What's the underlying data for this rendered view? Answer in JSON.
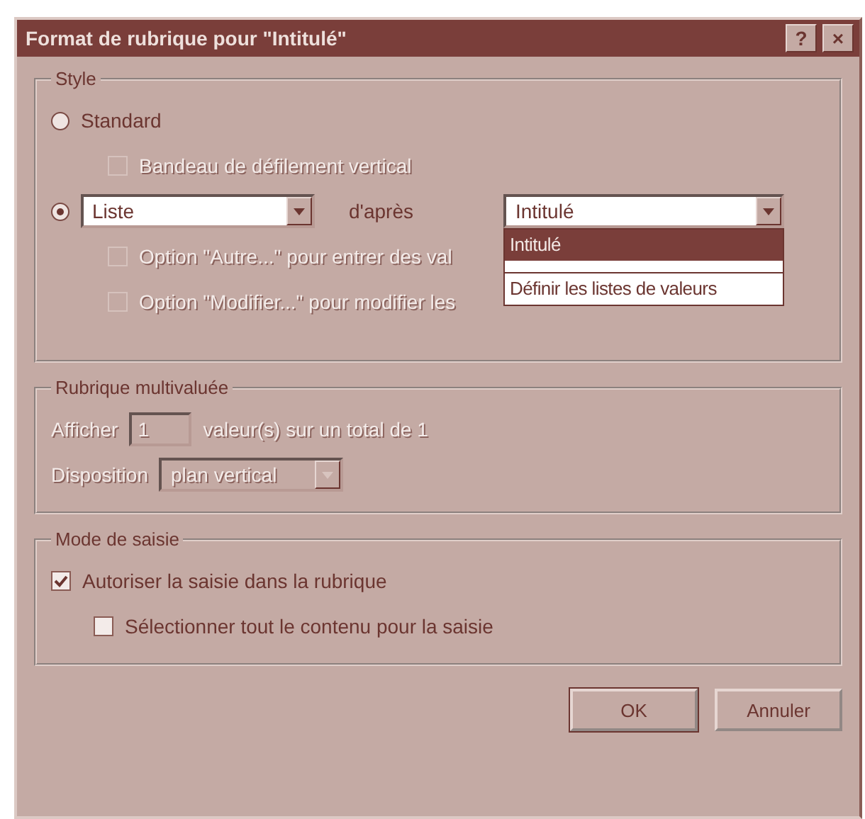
{
  "window": {
    "title": "Format de rubrique pour \"Intitulé\"",
    "help_button": "?",
    "close_button": "×"
  },
  "style_group": {
    "title": "Style",
    "standard": {
      "label": "Standard",
      "selected": false
    },
    "scrollbar_option": {
      "label": "Bandeau de défilement vertical",
      "checked": false,
      "disabled": true
    },
    "list": {
      "selected": true,
      "type_value": "Liste",
      "after_label": "d'après",
      "source_value": "Intitulé"
    },
    "list_options": [
      {
        "label": "Option \"Autre...\" pour entrer des val",
        "checked": false,
        "disabled": true
      },
      {
        "label": "Option \"Modifier...\" pour modifier les",
        "checked": false,
        "disabled": true
      }
    ],
    "dropdown": {
      "items": [
        {
          "label": "Intitulé",
          "selected": true
        },
        {
          "selected": false,
          "kind": "blank"
        },
        {
          "label": "Définir les listes de valeurs",
          "selected": false
        }
      ]
    }
  },
  "multivalue_group": {
    "title": "Rubrique multivaluée",
    "disabled": true,
    "show_label": "Afficher",
    "show_value": "1",
    "show_suffix": "valeur(s) sur un total de 1",
    "layout_label": "Disposition",
    "layout_value": "plan vertical"
  },
  "entry_group": {
    "title": "Mode de saisie",
    "options": [
      {
        "label": "Autoriser la saisie dans la rubrique",
        "checked": true,
        "indent": false
      },
      {
        "label": "Sélectionner tout le contenu pour la saisie",
        "checked": false,
        "indent": true
      }
    ]
  },
  "buttons": [
    {
      "label": "OK"
    },
    {
      "label": "Annuler"
    }
  ]
}
